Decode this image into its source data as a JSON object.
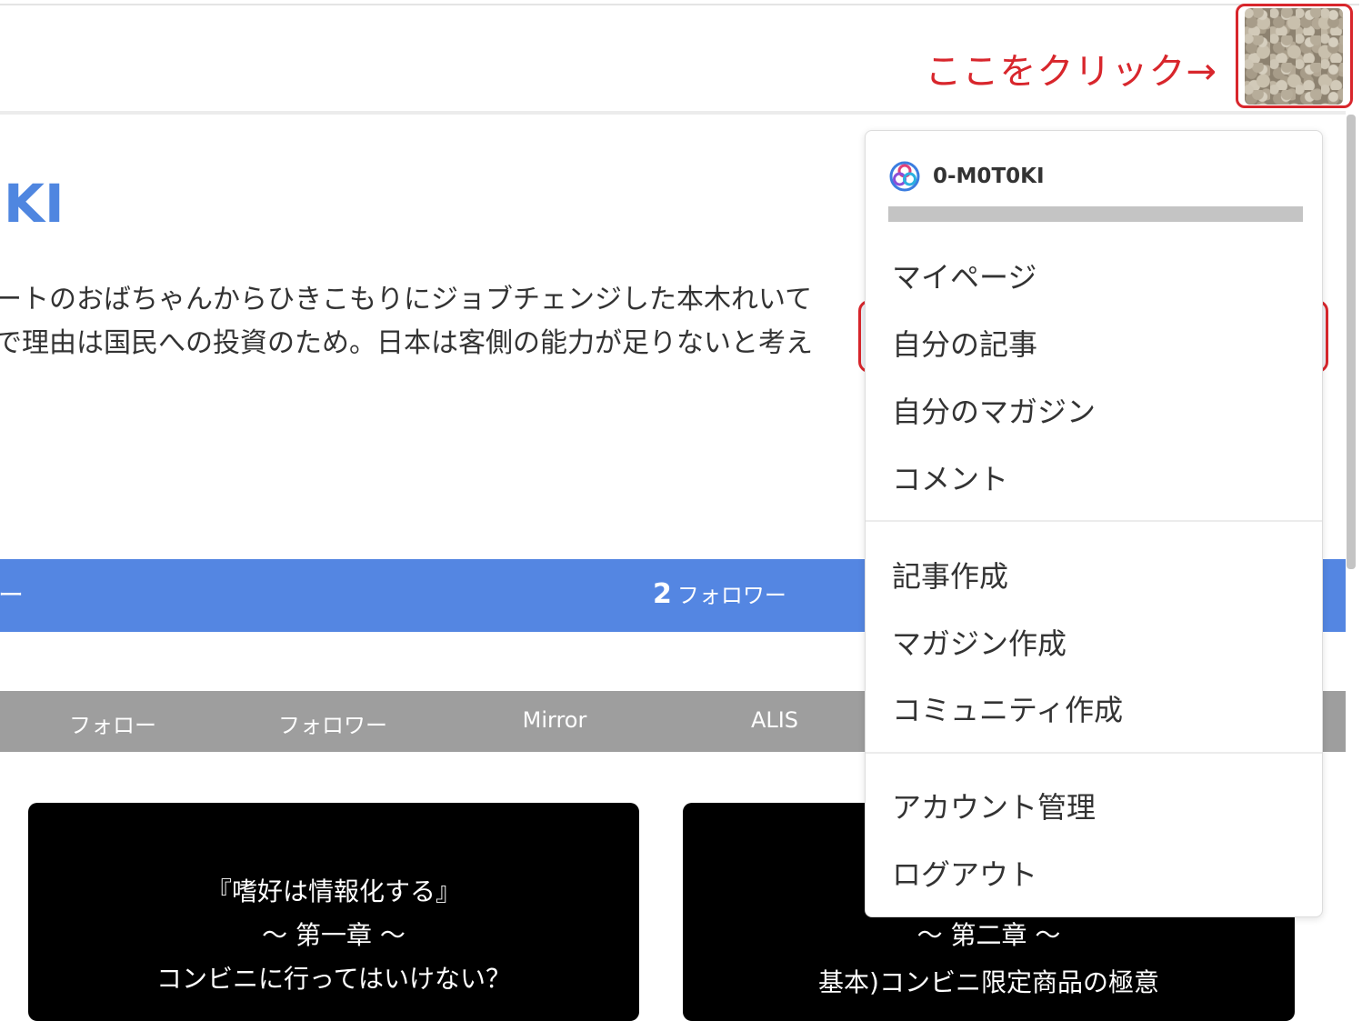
{
  "header": {
    "callout_text": "ここをクリック→"
  },
  "profile": {
    "name": "KI",
    "bio_line1": "ートのおばちゃんからひきこもりにジョブチェンジした本木れいて",
    "bio_line2": "で理由は国民への投資のため。日本は客側の能力が足りないと考え",
    "stats_left": "ー",
    "followers_count": "2",
    "followers_label": "フォロワー"
  },
  "tabs": [
    "フォロー",
    "フォロワー",
    "Mirror",
    "ALIS"
  ],
  "cards": [
    {
      "lines": [
        "『嗜好は情報化する』",
        "〜 第一章 〜",
        "コンビニに行ってはいけない？"
      ]
    },
    {
      "lines": [
        "〜 第二章 〜",
        "基本)コンビニ限定商品の極意"
      ]
    }
  ],
  "menu": {
    "username": "0-M0T0KI",
    "group1": [
      "マイページ",
      "自分の記事",
      "自分のマガジン",
      "コメント"
    ],
    "group2": [
      "記事作成",
      "マガジン作成",
      "コミュニティ作成"
    ],
    "group3": [
      "アカウント管理",
      "ログアウト"
    ]
  },
  "colors": {
    "accent_blue": "#5486e2",
    "highlight_red": "#d8262c",
    "tab_gray": "#9e9e9e"
  }
}
